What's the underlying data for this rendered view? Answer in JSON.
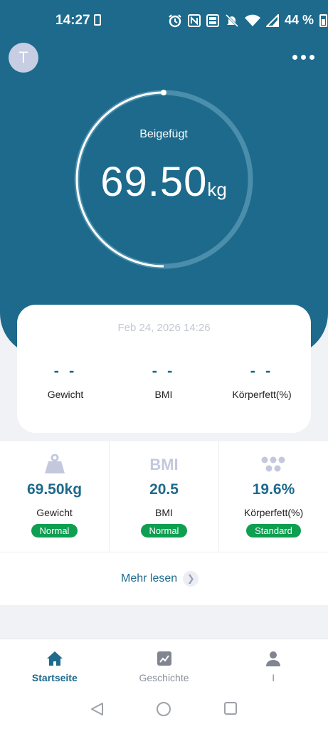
{
  "status_bar": {
    "time": "14:27",
    "battery_percent": "44 %",
    "icons": [
      "sim-card-icon",
      "alarm-icon",
      "nfc-icon",
      "volte-icon",
      "mute-icon",
      "wifi-icon",
      "signal-icon",
      "battery-icon"
    ]
  },
  "header": {
    "avatar_initial": "T",
    "menu_icon": "more-horizontal-icon"
  },
  "gauge": {
    "label": "Beigefügt",
    "value": "69.50",
    "unit": "kg",
    "progress_fraction": 0.5
  },
  "measurement_card": {
    "date": "Feb 24, 2026 14:26",
    "items": [
      {
        "value": "- -",
        "label": "Gewicht"
      },
      {
        "value": "- -",
        "label": "BMI"
      },
      {
        "value": "- -",
        "label": "Körperfett(%)"
      }
    ]
  },
  "metrics": [
    {
      "icon": "weight-icon",
      "value": "69.50kg",
      "label": "Gewicht",
      "status": "Normal"
    },
    {
      "icon": "bmi-icon",
      "icon_text": "BMI",
      "value": "20.5",
      "label": "BMI",
      "status": "Normal"
    },
    {
      "icon": "body-fat-icon",
      "value": "19.6%",
      "label": "Körperfett(%)",
      "status": "Standard"
    }
  ],
  "more": {
    "label": "Mehr lesen"
  },
  "tabs": [
    {
      "icon": "home-icon",
      "label": "Startseite",
      "active": true
    },
    {
      "icon": "chart-icon",
      "label": "Geschichte",
      "active": false
    },
    {
      "icon": "person-icon",
      "label": "I",
      "active": false
    }
  ],
  "colors": {
    "primary": "#1d6a8c",
    "badge_green": "#0e9f51",
    "background": "#f1f2f6"
  }
}
